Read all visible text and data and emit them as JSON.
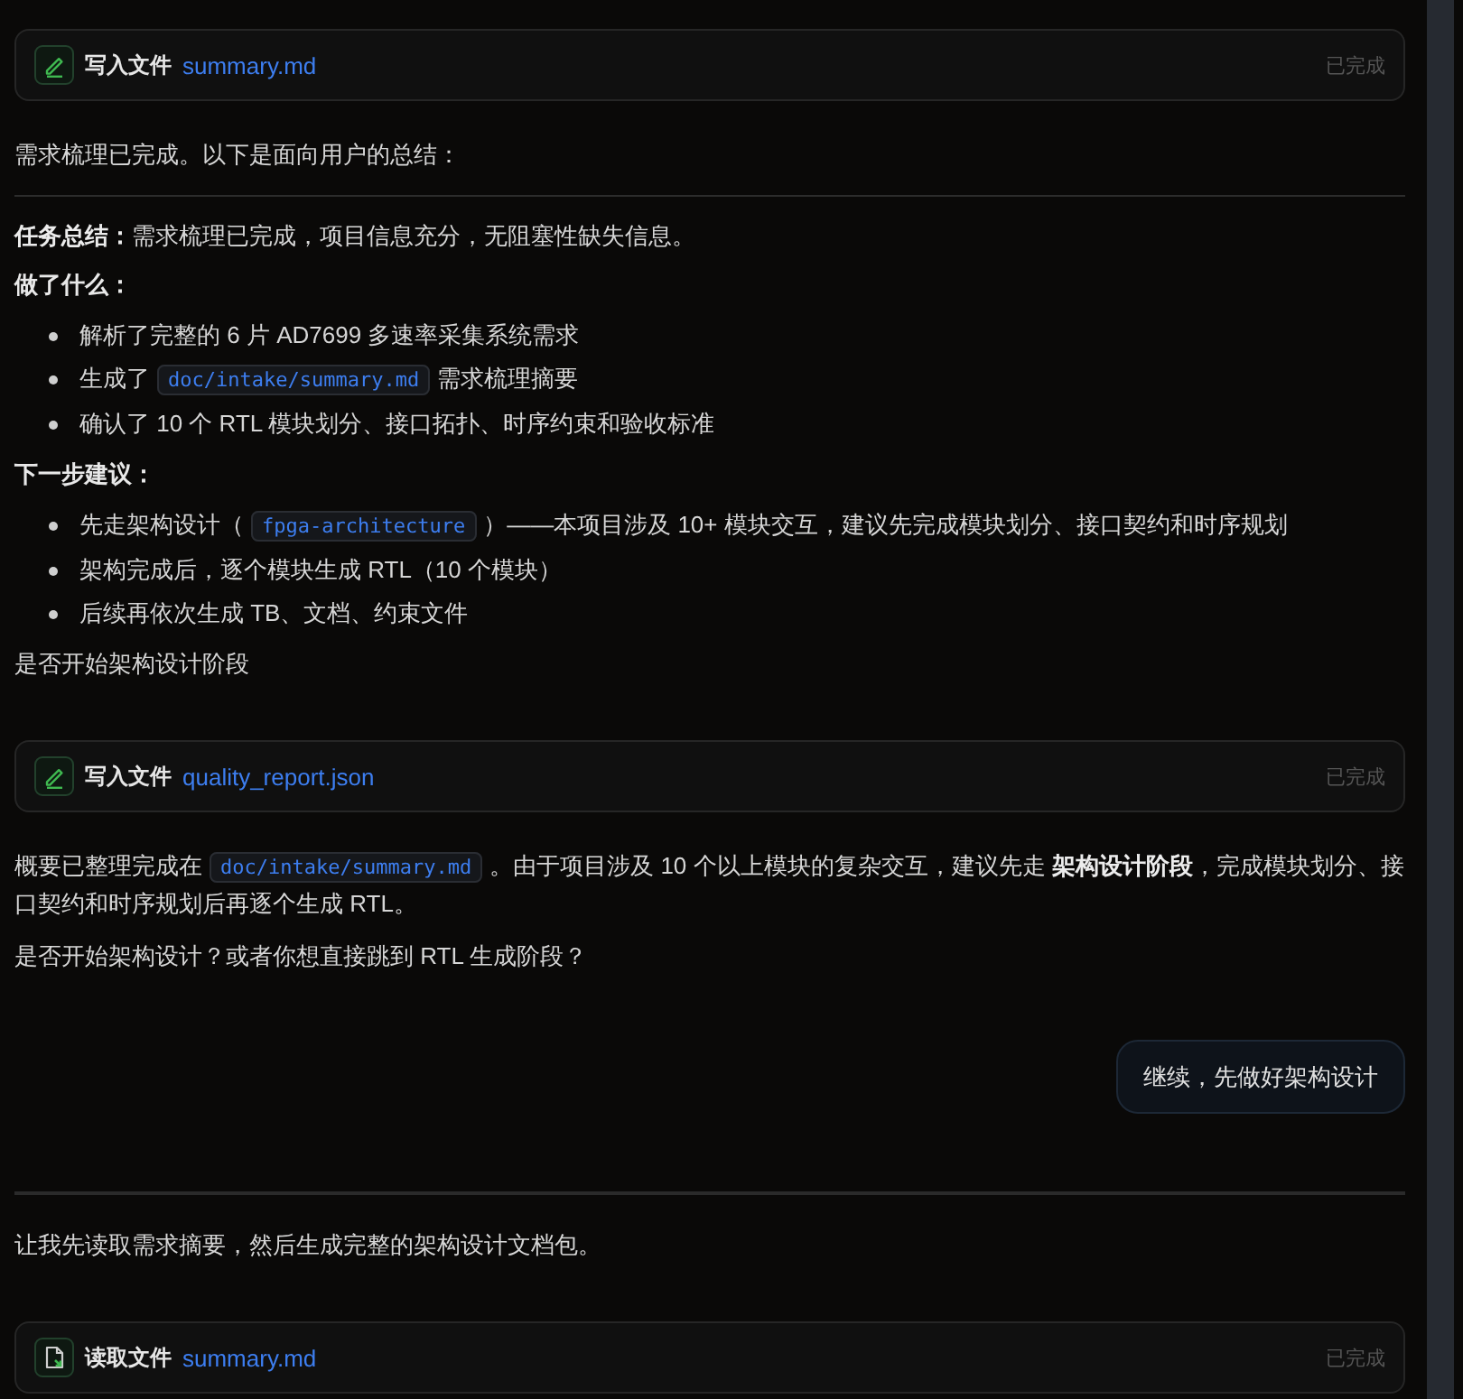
{
  "conversation": [
    {
      "kind": "file_write",
      "action": "写入文件",
      "file": "summary.md",
      "status": "已完成"
    },
    {
      "kind": "assistant",
      "blocks": [
        {
          "kind": "paragraph",
          "text": "需求梳理已完成。以下是面向用户的总结："
        },
        {
          "kind": "rule"
        },
        {
          "kind": "paragraph",
          "text": "**任务总结：**需求梳理已完成，项目信息充分，无阻塞性缺失信息。"
        },
        {
          "kind": "heading",
          "text": "做了什么："
        },
        {
          "kind": "list",
          "items": [
            {
              "parts": [
                {
                  "kind": "text",
                  "text": "解析了完整的 6 片 AD7699 多速率采集系统需求"
                }
              ]
            },
            {
              "parts": [
                {
                  "kind": "text",
                  "text": "生成了"
                },
                {
                  "kind": "code",
                  "text": "doc/intake/summary.md"
                },
                {
                  "kind": "text",
                  "text": "需求梳理摘要"
                }
              ]
            },
            {
              "parts": [
                {
                  "kind": "text",
                  "text": "确认了 10 个 RTL 模块划分、接口拓扑、时序约束和验收标准"
                }
              ]
            }
          ]
        },
        {
          "kind": "heading",
          "text": "下一步建议："
        },
        {
          "kind": "list",
          "items": [
            {
              "parts": [
                {
                  "kind": "text",
                  "text": "先走架构设计（"
                },
                {
                  "kind": "code",
                  "text": "fpga-architecture"
                },
                {
                  "kind": "text",
                  "text": "）——本项目涉及 10+ 模块交互，建议先完成模块划分、接口契约和时序规划"
                }
              ]
            },
            {
              "parts": [
                {
                  "kind": "text",
                  "text": "架构完成后，逐个模块生成 RTL（10 个模块）"
                }
              ]
            },
            {
              "parts": [
                {
                  "kind": "text",
                  "text": "后续再依次生成 TB、文档、约束文件"
                }
              ]
            }
          ]
        },
        {
          "kind": "paragraph",
          "text": "是否开始架构设计阶段"
        }
      ]
    },
    {
      "kind": "file_write",
      "action": "写入文件",
      "file": "quality_report.json",
      "status": "已完成"
    },
    {
      "kind": "assistant",
      "blocks": [
        {
          "kind": "paragraph",
          "parts": [
            {
              "kind": "text",
              "text": "概要已整理完成在"
            },
            {
              "kind": "code",
              "text": "doc/intake/summary.md"
            },
            {
              "kind": "text",
              "text": "。由于项目涉及 10 个以上模块的复杂交互，建议先走 **架构设计阶段**，完成模块划分、接口契约和时序规划后再逐个生成 RTL。"
            }
          ]
        },
        {
          "kind": "paragraph",
          "text": "是否开始架构设计？或者你想直接跳到 RTL 生成阶段？"
        }
      ]
    },
    {
      "kind": "user",
      "text": "继续，先做好架构设计"
    },
    {
      "kind": "divider"
    },
    {
      "kind": "assistant",
      "blocks": [
        {
          "kind": "paragraph",
          "text": "让我先读取需求摘要，然后生成完整的架构设计文档包。"
        }
      ]
    },
    {
      "kind": "file_read",
      "action": "读取文件",
      "file": "summary.md",
      "status": "已完成"
    }
  ]
}
